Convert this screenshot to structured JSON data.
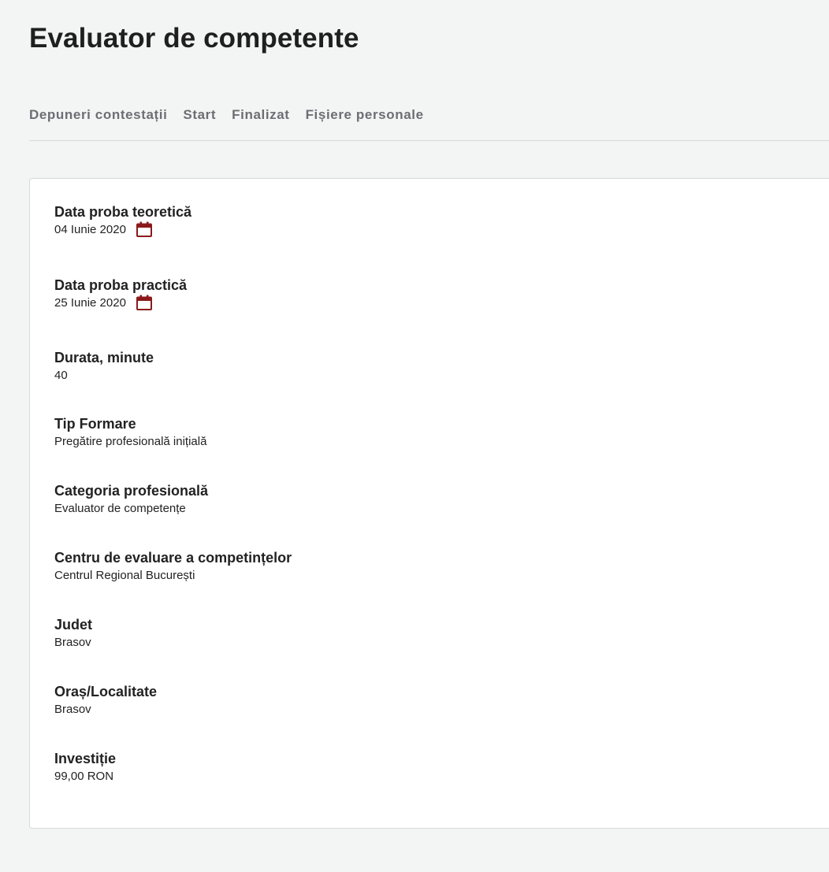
{
  "header": {
    "title": "Evaluator de competente"
  },
  "tabs": [
    {
      "label": "Depuneri contestații"
    },
    {
      "label": "Start"
    },
    {
      "label": "Finalizat"
    },
    {
      "label": "Fișiere personale"
    }
  ],
  "details": {
    "theory_date": {
      "label": "Data proba teoretică",
      "value": "04 Iunie 2020"
    },
    "practice_date": {
      "label": "Data proba practică",
      "value": "25 Iunie 2020"
    },
    "duration": {
      "label": "Durata, minute",
      "value": "40"
    },
    "training_type": {
      "label": "Tip Formare",
      "value": "Pregătire profesională inițială"
    },
    "category": {
      "label": "Categoria profesională",
      "value": "Evaluator de competențe"
    },
    "center": {
      "label": "Centru de evaluare a competințelor",
      "value": "Centrul Regional București"
    },
    "county": {
      "label": "Judet",
      "value": "Brasov"
    },
    "city": {
      "label": "Oraș/Localitate",
      "value": "Brasov"
    },
    "investment": {
      "label": "Investiție",
      "value": "99,00 RON"
    }
  },
  "colors": {
    "calendar_icon": "#8b1a1a",
    "tab_text": "#6b6f74",
    "background": "#f3f4f4"
  },
  "icons": {
    "calendar": "calendar-icon"
  }
}
